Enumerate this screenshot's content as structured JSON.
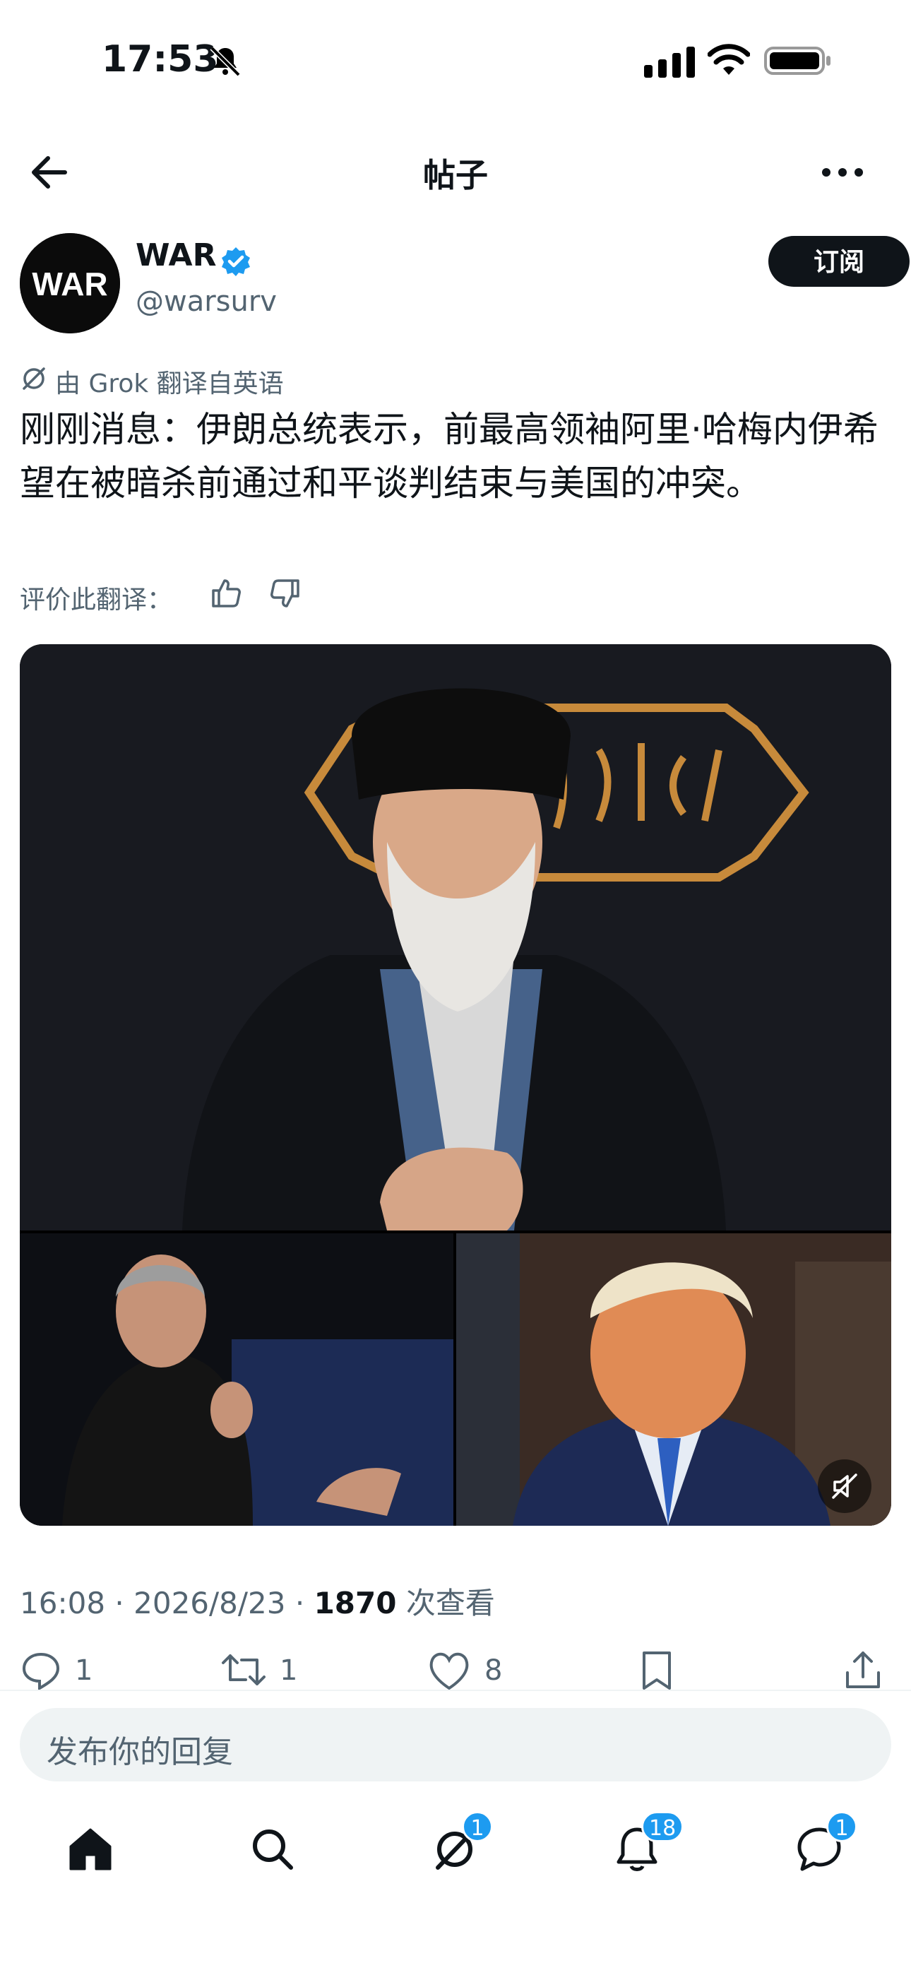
{
  "status_bar": {
    "time": "17:53"
  },
  "header": {
    "title": "帖子"
  },
  "author": {
    "name": "WAR",
    "handle": "@warsurv",
    "avatar_text": "WAR",
    "subscribe_label": "订阅"
  },
  "post": {
    "translation_note": "由 Grok 翻译自英语",
    "text": "刚刚消息：伊朗总统表示，前最高领袖阿里·哈梅内伊希望在被暗杀前通过和平谈判结束与美国的冲突。",
    "rate_label": "评价此翻译："
  },
  "meta": {
    "time": "16:08",
    "date": "2026/8/23",
    "views": "1870",
    "views_label": "次查看",
    "sep": "·"
  },
  "actions": {
    "replies": "1",
    "reposts": "1",
    "likes": "8"
  },
  "reply": {
    "placeholder": "发布你的回复"
  },
  "tabs": {
    "grok_badge": "1",
    "notifications_badge": "18",
    "messages_badge": "1"
  },
  "colors": {
    "accent": "#1d9bf0",
    "text": "#0f1419",
    "muted": "#536471"
  }
}
